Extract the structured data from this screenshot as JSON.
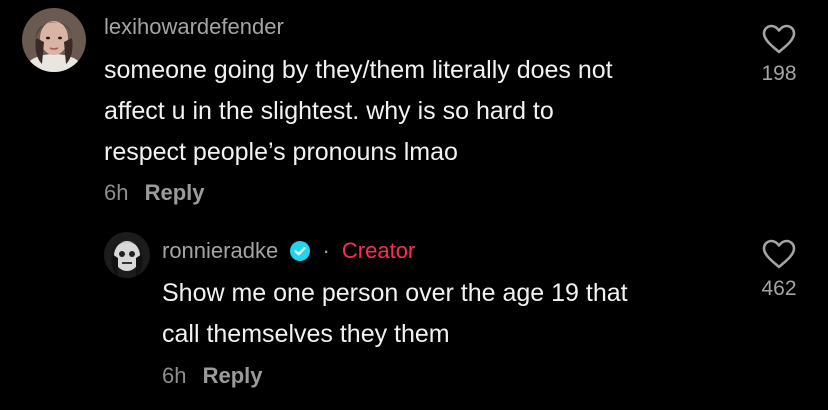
{
  "comments": [
    {
      "username": "lexihowardefender",
      "text_lines": [
        "someone going by they/them literally does not",
        "affect u in the slightest. why is so hard to",
        "respect people’s pronouns lmao"
      ],
      "time": "6h",
      "reply_label": "Reply",
      "like_count": "198",
      "like_icon": "heart-outline-icon"
    }
  ],
  "replies": [
    {
      "username": "ronnieradke",
      "verified_icon": "verified-badge-icon",
      "separator": "·",
      "badge": "Creator",
      "text_lines": [
        "Show me one person over the age 19 that",
        "call themselves they them"
      ],
      "time": "6h",
      "reply_label": "Reply",
      "like_count": "462",
      "like_icon": "heart-outline-icon"
    }
  ],
  "colors": {
    "background": "#000000",
    "creator_accent": "#fe2c55",
    "verified_blue": "#20d5ec"
  }
}
